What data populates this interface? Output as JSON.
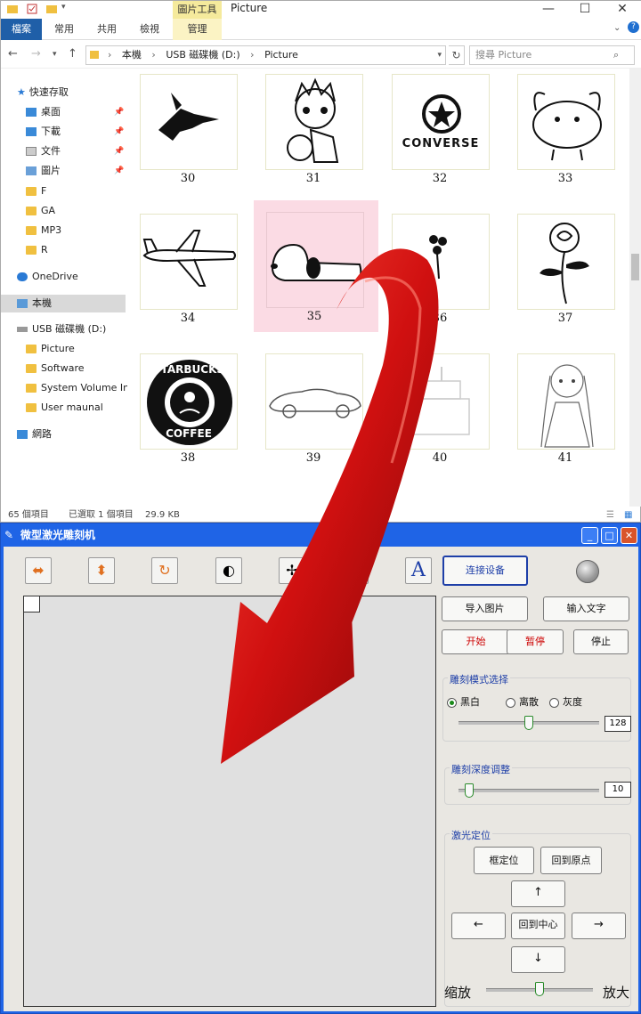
{
  "explorer": {
    "window_title": "Picture",
    "tool_tab": "圖片工具",
    "ribbon_tabs": [
      "檔案",
      "常用",
      "共用",
      "檢視",
      "管理"
    ],
    "breadcrumb": [
      "本機",
      "USB 磁碟機 (D:)",
      "Picture"
    ],
    "search_placeholder": "搜尋 Picture",
    "sidebar": {
      "quick_access": "快速存取",
      "quick_items": [
        "桌面",
        "下載",
        "文件",
        "圖片"
      ],
      "folders": [
        "F",
        "GA",
        "MP3",
        "R"
      ],
      "onedrive": "OneDrive",
      "this_pc": "本機",
      "usb": "USB 磁碟機 (D:)",
      "usb_items": [
        "Picture",
        "Software",
        "System Volume Inf",
        "User maunal"
      ],
      "network": "網路"
    },
    "files": [
      "30",
      "31",
      "32",
      "33",
      "34",
      "35",
      "36",
      "37",
      "38",
      "39",
      "40",
      "41"
    ],
    "selected_file": "35",
    "thumb_texts": {
      "converse": "CONVERSE",
      "starbucks_top": "STARBUCKS",
      "starbucks_bottom": "COFFEE"
    },
    "status": {
      "count": "65 個項目",
      "selected": "已選取 1 個項目",
      "size": "29.9 KB"
    }
  },
  "app": {
    "title": "微型激光雕刻机",
    "connect_label": "连接设备",
    "import_label": "导入图片",
    "text_label": "输入文字",
    "start_label": "开始",
    "pause_label": "暂停",
    "stop_label": "停止",
    "mode_group_label": "雕刻模式选择",
    "modes": [
      "黑白",
      "离散",
      "灰度"
    ],
    "selected_mode": "黑白",
    "threshold_value": "128",
    "threshold_level": 0.5,
    "depth_group_label": "雕刻深度调整",
    "depth_value": "10",
    "depth_level": 0.05,
    "laser_group_label": "激光定位",
    "frame_label": "框定位",
    "home_label": "回到原点",
    "up_label": "↑",
    "left_label": "←",
    "center_label": "回到中心",
    "right_label": "→",
    "down_label": "↓",
    "zoom_out_label": "缩放",
    "zoom_in_label": "放大",
    "zoom_level": 0.5
  }
}
